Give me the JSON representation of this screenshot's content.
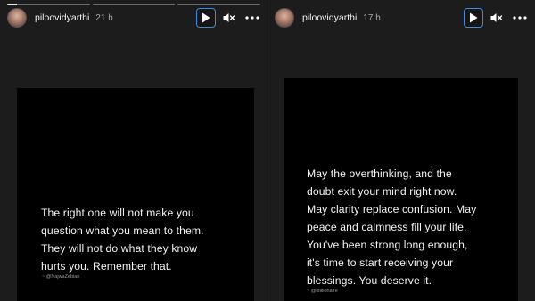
{
  "stories": [
    {
      "progress": [
        {
          "fill": 0.12
        },
        {
          "fill": 0
        },
        {
          "fill": 0
        }
      ],
      "username": "piloovidyarthi",
      "time": "21 h",
      "quote_lines": [
        "The right one will not make you",
        "question what you mean to them.",
        "They will not do what they know",
        "hurts you. Remember that."
      ],
      "credit": "~ @NajwaZebian"
    },
    {
      "progress": [
        {
          "fill": 0.0
        }
      ],
      "username": "piloovidyarthi",
      "time": "17 h",
      "quote_lines": [
        "May the overthinking, and the",
        "doubt exit your mind right now.",
        "May clarity replace confusion. May",
        "peace and calmness fill your life.",
        "You've been strong long enough,",
        "it's time to start receiving your",
        "blessings. You deserve it."
      ],
      "credit": "~ @idillionaire"
    }
  ],
  "icons": {
    "play": "play-icon",
    "mute": "speaker-muted-icon",
    "more": "more-horizontal-icon"
  },
  "colors": {
    "background": "#1c1c1c",
    "post_background": "#000000",
    "focus_outline": "#3a8dde",
    "text": "#ffffff",
    "secondary_text": "#a8a8a8"
  }
}
